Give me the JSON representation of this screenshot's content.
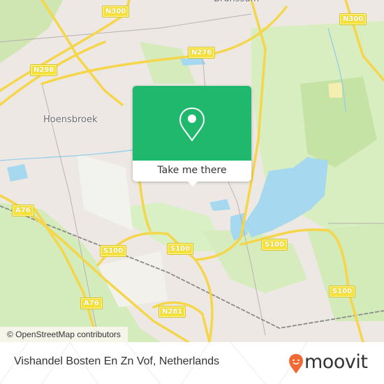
{
  "map": {
    "place_labels": [
      {
        "name": "Hoensbroek"
      },
      {
        "name": "Brunssum"
      }
    ],
    "road_shields": [
      {
        "ref": "N300"
      },
      {
        "ref": "N300"
      },
      {
        "ref": "N298"
      },
      {
        "ref": "N276"
      },
      {
        "ref": "A76"
      },
      {
        "ref": "A76"
      },
      {
        "ref": "S100"
      },
      {
        "ref": "S100"
      },
      {
        "ref": "S100"
      },
      {
        "ref": "S100"
      },
      {
        "ref": "N281"
      }
    ],
    "attribution": "© OpenStreetMap contributors"
  },
  "popup": {
    "icon": "map-pin-icon",
    "button_label": "Take me there",
    "accent_color": "#1fb86d"
  },
  "footer": {
    "location_title": "Vishandel Bosten En Zn Vof, Netherlands",
    "brand": "moovit",
    "brand_color": "#f06a35"
  }
}
